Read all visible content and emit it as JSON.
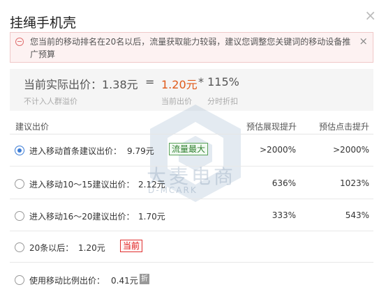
{
  "dialog": {
    "title": "挂绳手机壳"
  },
  "warning": {
    "text": "您当前的移动排名在20名以后，流量获取能力较弱，建议您调整您关键词的移动设备推广预算"
  },
  "summary": {
    "label": "当前实际出价：",
    "actual": "1.38元",
    "equals": "=",
    "bid": "1.20元",
    "multiplier": "* 115%",
    "sub_left": "不计入人群溢价",
    "sub_bid": "当前出价",
    "sub_discount": "分时折扣"
  },
  "table": {
    "headers": {
      "bid": "建议出价",
      "impressions": "预估展现提升",
      "clicks": "预估点击提升"
    },
    "rows": [
      {
        "label": "进入移动首条建议出价：",
        "price": "9.79元",
        "badge": "流量最大",
        "impressions": ">2000%",
        "clicks": ">2000%",
        "selected": true
      },
      {
        "label": "进入移动10～15建议出价：",
        "price": "2.12元",
        "impressions": "636%",
        "clicks": "1023%",
        "selected": false
      },
      {
        "label": "进入移动16～20建议出价：",
        "price": "1.70元",
        "impressions": "333%",
        "clicks": "543%",
        "selected": false
      },
      {
        "label": "20条以后：",
        "price": "1.20元",
        "badge": "当前",
        "selected": false
      },
      {
        "label": "使用移动比例出价：",
        "price": "0.41元",
        "badge": "折",
        "selected": false
      }
    ]
  },
  "watermark": {
    "main": "大麦电商",
    "sub": "D-MCARK"
  }
}
